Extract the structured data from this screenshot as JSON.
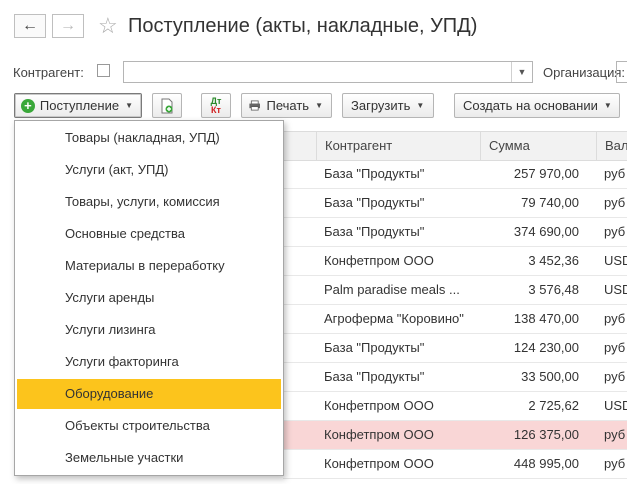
{
  "header": {
    "title": "Поступление (акты, накладные, УПД)",
    "back_icon": "←",
    "forward_icon": "→",
    "star_icon": "☆"
  },
  "filters": {
    "contractor_label": "Контрагент:",
    "contractor_value": "",
    "organization_label": "Организация:"
  },
  "toolbar": {
    "receipt_label": "Поступление",
    "print_label": "Печать",
    "load_label": "Загрузить",
    "create_based_label": "Создать на основании",
    "dtkt_top": "Дт",
    "dtkt_bottom": "Кт"
  },
  "menu": {
    "items": [
      "Товары (накладная, УПД)",
      "Услуги (акт, УПД)",
      "Товары, услуги, комиссия",
      "Основные средства",
      "Материалы в переработку",
      "Услуги аренды",
      "Услуги лизинга",
      "Услуги факторинга",
      "Оборудование",
      "Объекты строительства",
      "Земельные участки"
    ],
    "selected_index": 8
  },
  "table": {
    "columns": {
      "contractor": "Контрагент",
      "sum": "Сумма",
      "currency": "Вал"
    },
    "rows": [
      {
        "contractor": "База \"Продукты\"",
        "sum": "257 970,00",
        "currency": "руб"
      },
      {
        "contractor": "База \"Продукты\"",
        "sum": "79 740,00",
        "currency": "руб"
      },
      {
        "contractor": "База \"Продукты\"",
        "sum": "374 690,00",
        "currency": "руб"
      },
      {
        "contractor": "Конфетпром ООО",
        "sum": "3 452,36",
        "currency": "USD"
      },
      {
        "contractor": "Palm paradise meals ...",
        "sum": "3 576,48",
        "currency": "USD"
      },
      {
        "contractor": "Агроферма \"Коровино\"",
        "sum": "138 470,00",
        "currency": "руб"
      },
      {
        "contractor": "База \"Продукты\"",
        "sum": "124 230,00",
        "currency": "руб"
      },
      {
        "contractor": "База \"Продукты\"",
        "sum": "33 500,00",
        "currency": "руб"
      },
      {
        "contractor": "Конфетпром ООО",
        "sum": "2 725,62",
        "currency": "USD"
      },
      {
        "contractor": "Конфетпром ООО",
        "sum": "126 375,00",
        "currency": "руб",
        "highlight": true
      },
      {
        "contractor": "Конфетпром ООО",
        "sum": "448 995,00",
        "currency": "руб"
      }
    ]
  },
  "colors": {
    "selected_menu_item": "#fcc41c",
    "highlighted_row": "#f9d6d6",
    "add_icon": "#3aa83a"
  }
}
